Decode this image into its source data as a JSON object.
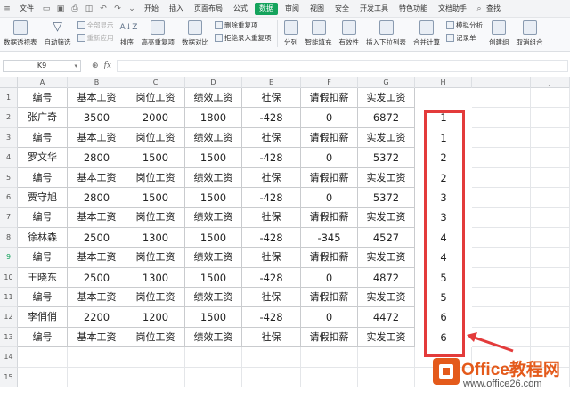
{
  "menu": {
    "file": "文件",
    "tabs": [
      "开始",
      "插入",
      "页面布局",
      "公式",
      "数据",
      "审阅",
      "视图",
      "安全",
      "开发工具",
      "特色功能",
      "文档助手"
    ],
    "active_tab": "数据",
    "search": "查找"
  },
  "ribbon": {
    "pivot": "数据透视表",
    "autofilter": "自动筛选",
    "show_all": "全部显示",
    "reapply": "重新应用",
    "sort": "排序",
    "highlight_dup": "高亮重复项",
    "compare": "数据对比",
    "remove_dup": "删除重复项",
    "reject_dup": "拒绝录入重复项",
    "split": "分列",
    "smart_fill": "智能填充",
    "validity": "有效性",
    "dropdown": "插入下拉列表",
    "consolidate": "合并计算",
    "simulate": "模拟分析",
    "record": "记录单",
    "create_group": "创建组",
    "ungroup": "取消组合"
  },
  "formula_bar": {
    "cell_ref": "K9",
    "fx": "fx",
    "value": ""
  },
  "columns": [
    "A",
    "B",
    "C",
    "D",
    "E",
    "F",
    "G",
    "H",
    "I",
    "J"
  ],
  "rows": [
    "1",
    "2",
    "3",
    "4",
    "5",
    "6",
    "7",
    "8",
    "9",
    "10",
    "11",
    "12",
    "13",
    "14",
    "15"
  ],
  "table": [
    [
      "编号",
      "基本工资",
      "岗位工资",
      "绩效工资",
      "社保",
      "请假扣薪",
      "实发工资",
      ""
    ],
    [
      "张广奇",
      "3500",
      "2000",
      "1800",
      "-428",
      "0",
      "6872",
      "1"
    ],
    [
      "编号",
      "基本工资",
      "岗位工资",
      "绩效工资",
      "社保",
      "请假扣薪",
      "实发工资",
      "1"
    ],
    [
      "罗文华",
      "2800",
      "1500",
      "1500",
      "-428",
      "0",
      "5372",
      "2"
    ],
    [
      "编号",
      "基本工资",
      "岗位工资",
      "绩效工资",
      "社保",
      "请假扣薪",
      "实发工资",
      "2"
    ],
    [
      "贾守旭",
      "2800",
      "1500",
      "1500",
      "-428",
      "0",
      "5372",
      "3"
    ],
    [
      "编号",
      "基本工资",
      "岗位工资",
      "绩效工资",
      "社保",
      "请假扣薪",
      "实发工资",
      "3"
    ],
    [
      "徐林森",
      "2500",
      "1300",
      "1500",
      "-428",
      "-345",
      "4527",
      "4"
    ],
    [
      "编号",
      "基本工资",
      "岗位工资",
      "绩效工资",
      "社保",
      "请假扣薪",
      "实发工资",
      "4"
    ],
    [
      "王晓东",
      "2500",
      "1300",
      "1500",
      "-428",
      "0",
      "4872",
      "5"
    ],
    [
      "编号",
      "基本工资",
      "岗位工资",
      "绩效工资",
      "社保",
      "请假扣薪",
      "实发工资",
      "5"
    ],
    [
      "李俏俏",
      "2200",
      "1200",
      "1500",
      "-428",
      "0",
      "4472",
      "6"
    ],
    [
      "编号",
      "基本工资",
      "岗位工资",
      "绩效工资",
      "社保",
      "请假扣薪",
      "实发工资",
      "6"
    ]
  ],
  "selected_row": "9",
  "colors": {
    "accent": "#14a35c",
    "highlight": "#e33b3b",
    "brand": "#e45a1b"
  },
  "watermark": {
    "title_en": "Office",
    "title_cn": "教程网",
    "url": "www.office26.com"
  }
}
